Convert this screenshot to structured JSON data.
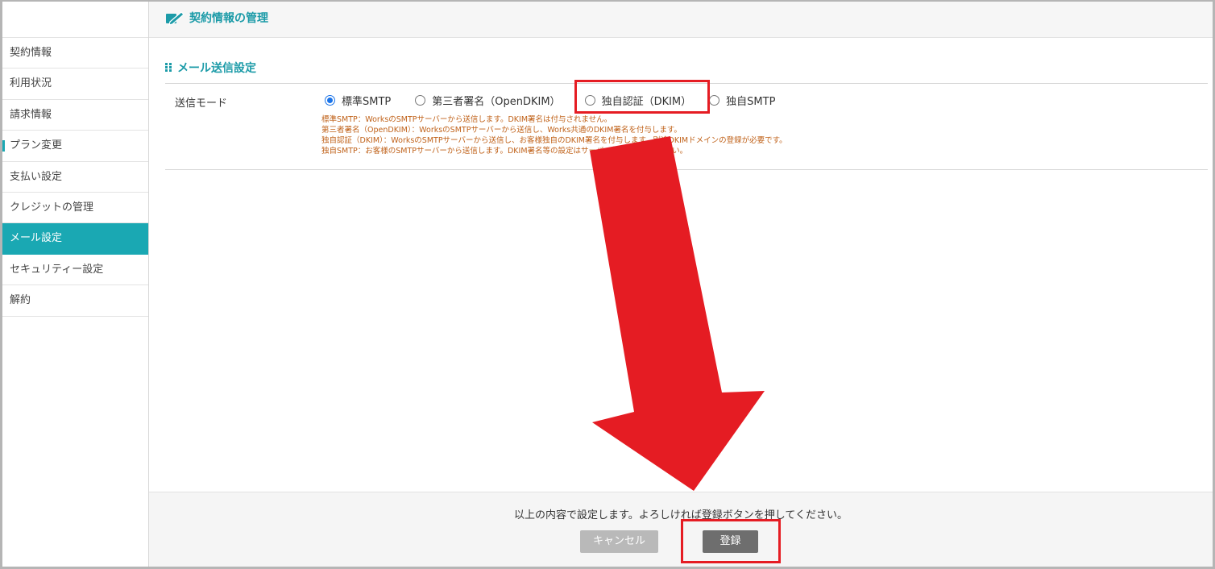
{
  "header": {
    "title": "契約情報の管理",
    "icon": "edit-pen-icon"
  },
  "sidebar": {
    "items": [
      {
        "label": "契約情報",
        "active": false
      },
      {
        "label": "利用状況",
        "active": false
      },
      {
        "label": "請求情報",
        "active": false
      },
      {
        "label": "プラン変更",
        "active": false
      },
      {
        "label": "支払い設定",
        "active": false
      },
      {
        "label": "クレジットの管理",
        "active": false
      },
      {
        "label": "メール設定",
        "active": true
      },
      {
        "label": "セキュリティー設定",
        "active": false
      },
      {
        "label": "解約",
        "active": false
      }
    ]
  },
  "main": {
    "section_title": "メール送信設定",
    "send_mode": {
      "label": "送信モード",
      "options": [
        {
          "label": "標準SMTP",
          "checked": true
        },
        {
          "label": "第三者署名（OpenDKIM）",
          "checked": false
        },
        {
          "label": "独自認証（DKIM）",
          "checked": false
        },
        {
          "label": "独自SMTP",
          "checked": false
        }
      ],
      "notes": [
        "標準SMTP：WorksのSMTPサーバーから送信します。DKIM署名は付与されません。",
        "第三者署名（OpenDKIM）：WorksのSMTPサーバーから送信し、Works共通のDKIM署名を付与します。",
        "独自認証（DKIM）：WorksのSMTPサーバーから送信し、お客様独自のDKIM署名を付与します。別途DKIMドメインの登録が必要です。",
        "独自SMTP：お客様のSMTPサーバーから送信します。DKIM署名等の設定はサーバー側で行ってください。"
      ]
    }
  },
  "footer": {
    "message": "以上の内容で設定します。よろしければ登録ボタンを押してください。",
    "cancel_label": "キャンセル",
    "register_label": "登録"
  },
  "colors": {
    "accent": "#1aa8b3",
    "annotation": "#e51c23",
    "note_text": "#c0621a"
  }
}
